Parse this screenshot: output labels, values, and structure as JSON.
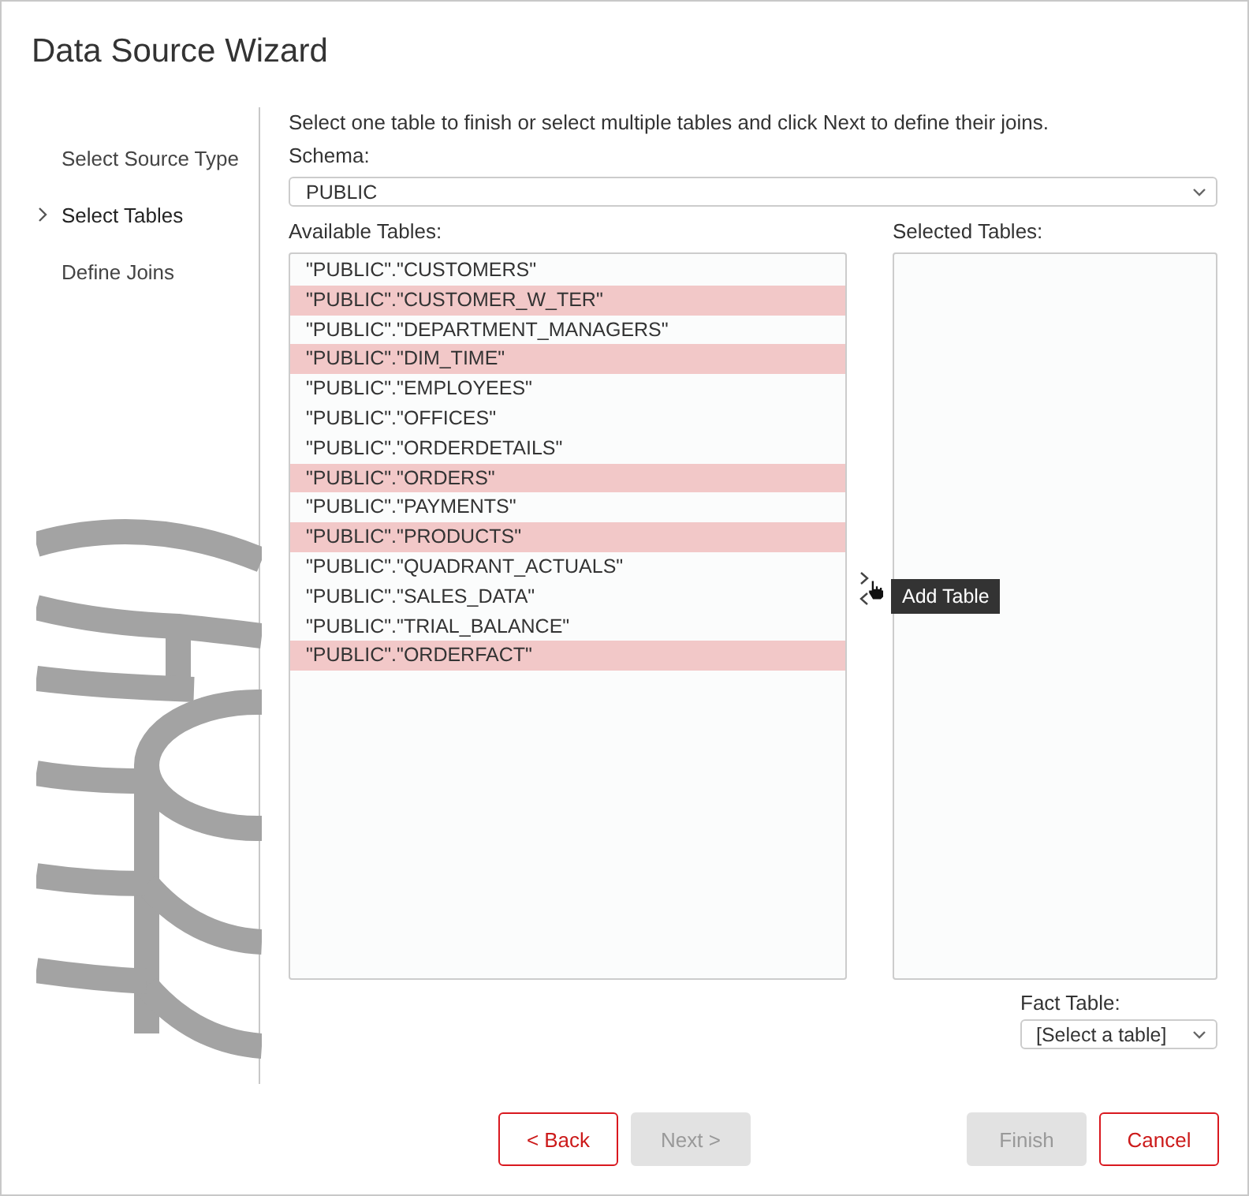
{
  "window": {
    "title": "Data Source Wizard"
  },
  "steps": [
    {
      "label": "Select Source Type",
      "selected": false
    },
    {
      "label": "Select Tables",
      "selected": true
    },
    {
      "label": "Define Joins",
      "selected": false
    }
  ],
  "instruction": "Select one table to finish or select multiple tables and click Next to define their joins.",
  "schema": {
    "label": "Schema:",
    "value": "PUBLIC"
  },
  "available_tables": {
    "label": "Available Tables:",
    "items": [
      {
        "label": "\"PUBLIC\".\"CUSTOMERS\"",
        "selected": false
      },
      {
        "label": "\"PUBLIC\".\"CUSTOMER_W_TER\"",
        "selected": true
      },
      {
        "label": "\"PUBLIC\".\"DEPARTMENT_MANAGERS\"",
        "selected": false
      },
      {
        "label": "\"PUBLIC\".\"DIM_TIME\"",
        "selected": true
      },
      {
        "label": "\"PUBLIC\".\"EMPLOYEES\"",
        "selected": false
      },
      {
        "label": "\"PUBLIC\".\"OFFICES\"",
        "selected": false
      },
      {
        "label": "\"PUBLIC\".\"ORDERDETAILS\"",
        "selected": false
      },
      {
        "label": "\"PUBLIC\".\"ORDERS\"",
        "selected": true
      },
      {
        "label": "\"PUBLIC\".\"PAYMENTS\"",
        "selected": false
      },
      {
        "label": "\"PUBLIC\".\"PRODUCTS\"",
        "selected": true
      },
      {
        "label": "\"PUBLIC\".\"QUADRANT_ACTUALS\"",
        "selected": false
      },
      {
        "label": "\"PUBLIC\".\"SALES_DATA\"",
        "selected": false
      },
      {
        "label": "\"PUBLIC\".\"TRIAL_BALANCE\"",
        "selected": false
      },
      {
        "label": "\"PUBLIC\".\"ORDERFACT\"",
        "selected": true
      }
    ]
  },
  "selected_tables": {
    "label": "Selected Tables:"
  },
  "tooltip": "Add Table",
  "fact_table": {
    "label": "Fact Table:",
    "value": "[Select a table]"
  },
  "buttons": [
    {
      "label": "< Back",
      "disabled": false
    },
    {
      "label": "Next >",
      "disabled": true
    },
    {
      "label": "Finish",
      "disabled": true
    },
    {
      "label": "Cancel",
      "disabled": false
    }
  ]
}
